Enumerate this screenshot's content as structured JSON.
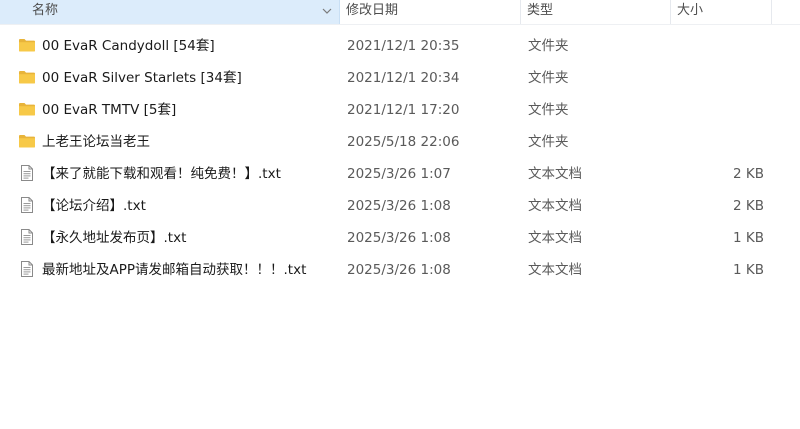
{
  "columns": {
    "name": "名称",
    "date": "修改日期",
    "type": "类型",
    "size": "大小"
  },
  "files": [
    {
      "name": "00 EvaR Candydoll [54套]",
      "date": "2021/12/1 20:35",
      "type": "文件夹",
      "size": "",
      "icon": "folder-icon"
    },
    {
      "name": "00 EvaR Silver Starlets [34套]",
      "date": "2021/12/1 20:34",
      "type": "文件夹",
      "size": "",
      "icon": "folder-icon"
    },
    {
      "name": "00 EvaR TMTV [5套]",
      "date": "2021/12/1 17:20",
      "type": "文件夹",
      "size": "",
      "icon": "folder-icon"
    },
    {
      "name": "上老王论坛当老王",
      "date": "2025/5/18 22:06",
      "type": "文件夹",
      "size": "",
      "icon": "folder-icon"
    },
    {
      "name": "【来了就能下载和观看！纯免费！】.txt",
      "date": "2025/3/26 1:07",
      "type": "文本文档",
      "size": "2 KB",
      "icon": "text-file-icon"
    },
    {
      "name": "【论坛介绍】.txt",
      "date": "2025/3/26 1:08",
      "type": "文本文档",
      "size": "2 KB",
      "icon": "text-file-icon"
    },
    {
      "name": "【永久地址发布页】.txt",
      "date": "2025/3/26 1:08",
      "type": "文本文档",
      "size": "1 KB",
      "icon": "text-file-icon"
    },
    {
      "name": "最新地址及APP请发邮箱自动获取！！！.txt",
      "date": "2025/3/26 1:08",
      "type": "文本文档",
      "size": "1 KB",
      "icon": "text-file-icon"
    }
  ],
  "colors": {
    "folder": "#f7c948",
    "folder_dark": "#e8b43a",
    "header_selected": "#dcecfb"
  }
}
